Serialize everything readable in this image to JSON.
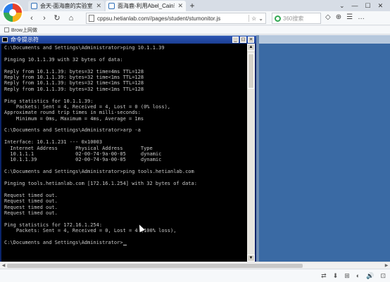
{
  "tabs": [
    {
      "label": "会天-面海鹿的实验室",
      "active": false
    },
    {
      "label": "面海鹿-利用Abel_Cain软件",
      "active": true
    }
  ],
  "new_tab_label": "+",
  "window_controls": [
    "⌄",
    "—",
    "☐",
    "✕"
  ],
  "nav": {
    "back": "‹",
    "forward": "›",
    "reload": "↻",
    "home": "⌂",
    "url": "cppsu.hetianlab.com//pages/student/stumonitor.js",
    "star": "☆",
    "dropdown": "⌄",
    "search_placeholder": "360搜索"
  },
  "toolbar_icons": [
    "◇",
    "⊕",
    "☰",
    "…"
  ],
  "bookmarks": [
    "Brow上网做"
  ],
  "cmd": {
    "title": "命令提示符",
    "buttons": [
      "_",
      "□",
      "×"
    ],
    "lines": [
      "C:\\Documents and Settings\\Administrator>ping 10.1.1.39",
      "",
      "Pinging 10.1.1.39 with 32 bytes of data:",
      "",
      "Reply from 10.1.1.39: bytes=32 time=4ms TTL=128",
      "Reply from 10.1.1.39: bytes=32 time<1ms TTL=128",
      "Reply from 10.1.1.39: bytes=32 time<1ms TTL=128",
      "Reply from 10.1.1.39: bytes=32 time<1ms TTL=128",
      "",
      "Ping statistics for 10.1.1.39:",
      "    Packets: Sent = 4, Received = 4, Lost = 0 (0% loss),",
      "Approximate round trip times in milli-seconds:",
      "    Minimum = 0ms, Maximum = 4ms, Average = 1ms",
      "",
      "C:\\Documents and Settings\\Administrator>arp -a",
      "",
      "Interface: 10.1.1.231 --- 0x10003",
      "  Internet Address      Physical Address      Type",
      "  10.1.1.1              02-00-74-9a-00-05     dynamic",
      "  10.1.1.39             02-00-74-9a-00-05     dynamic",
      "",
      "C:\\Documents and Settings\\Administrator>ping tools.hetianlab.com",
      "",
      "Pinging tools.hetianlab.com [172.16.1.254] with 32 bytes of data:",
      "",
      "Request timed out.",
      "Request timed out.",
      "Request timed out.",
      "Request timed out.",
      "",
      "Ping statistics for 172.16.1.254:",
      "    Packets: Sent = 4, Received = 0, Lost = 4 (100% loss),",
      "",
      "C:\\Documents and Settings\\Administrator>"
    ]
  },
  "status_icons": [
    "⇄",
    "⬇",
    "⊞",
    "◐",
    "🔊",
    "⊡"
  ]
}
